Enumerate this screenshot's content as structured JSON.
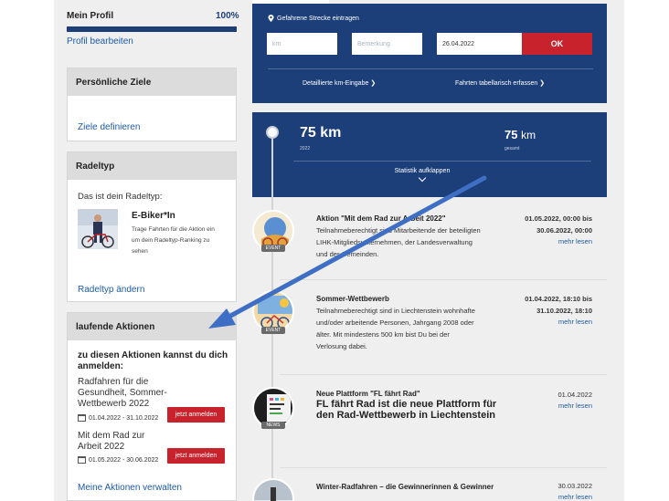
{
  "profile": {
    "title": "Mein Profil",
    "percent_label": "100%",
    "progress": 1.0,
    "edit_link": "Profil bearbeiten"
  },
  "goals_card": {
    "title": "Persönliche Ziele",
    "link": "Ziele definieren"
  },
  "rider_type_card": {
    "title": "Radeltyp",
    "intro": "Das ist dein Radeltyp:",
    "type_name": "E-Biker*In",
    "description": "Trage Fahrten für die Aktion ein um dein Radeltyp-Ranking zu sehen",
    "link": "Radeltyp ändern"
  },
  "running_actions_card": {
    "title": "laufende Aktionen",
    "intro": "zu diesen Aktionen kannst du dich anmelden:",
    "items": [
      {
        "title": "Radfahren für die Gesundheit, Sommer-Wettbewerb 2022",
        "dates": "01.04.2022 - 31.10.2022",
        "button": "jetzt anmelden"
      },
      {
        "title": "Mit dem Rad zur Arbeit 2022",
        "dates": "01.05.2022 - 30.06.2022",
        "button": "jetzt anmelden"
      }
    ],
    "link": "Meine Aktionen verwalten"
  },
  "entry_form": {
    "label": "Gefahrene Strecke eintragen",
    "km_placeholder": "km",
    "note_placeholder": "Bemerkung",
    "date_value": "26.04.2022",
    "ok_label": "OK",
    "link_detail": "Detaillierte km-Eingabe",
    "link_table": "Fahrten tabellarisch erfassen"
  },
  "stats": {
    "year_value": "75 km",
    "year_label": "2022",
    "total_number": "75",
    "total_unit": "km",
    "total_label": "gesamt",
    "toggle_label": "Statistik aufklappen"
  },
  "feed": [
    {
      "badge": "EVENT",
      "title": "Aktion \"Mit dem Rad zur Arbeit 2022\"",
      "text": "Teilnahmeberechtigt sind Mitarbeitende der beteiligten LIHK-Mitgliedsunternehmen, der Landesverwaltung und der Gemeinden.",
      "date_from": "01.05.2022, 00:00 bis",
      "date_to": "30.06.2022, 00:00",
      "more": "mehr lesen"
    },
    {
      "badge": "EVENT",
      "title": "Sommer-Wettbewerb",
      "text": "Teilnahmeberechtigt sind in Liechtenstein wohnhafte und/oder arbeitende Personen, Jahrgang 2008 oder älter. Mit mindestens 500 km bist Du bei der Verlosung dabei.",
      "date_from": "01.04.2022, 18:10 bis",
      "date_to": "31.10.2022, 18:10",
      "more": "mehr lesen"
    },
    {
      "badge": "NEWS",
      "title": "Neue Plattform \"FL fährt Rad\"",
      "headline": "FL fährt Rad ist die neue Plattform für den Rad-Wettbewerb in Liechtenstein",
      "date": "01.04.2022",
      "more": "mehr lesen"
    },
    {
      "title": "Winter-Radfahren – die Gewinnerinnen & Gewinner",
      "date": "30.03.2022",
      "more": "mehr lesen"
    }
  ],
  "colors": {
    "brand_blue": "#1d3f79",
    "accent_red": "#c8232c",
    "link_blue": "#1d5aa6",
    "annotation_arrow": "#3f6fc4"
  }
}
